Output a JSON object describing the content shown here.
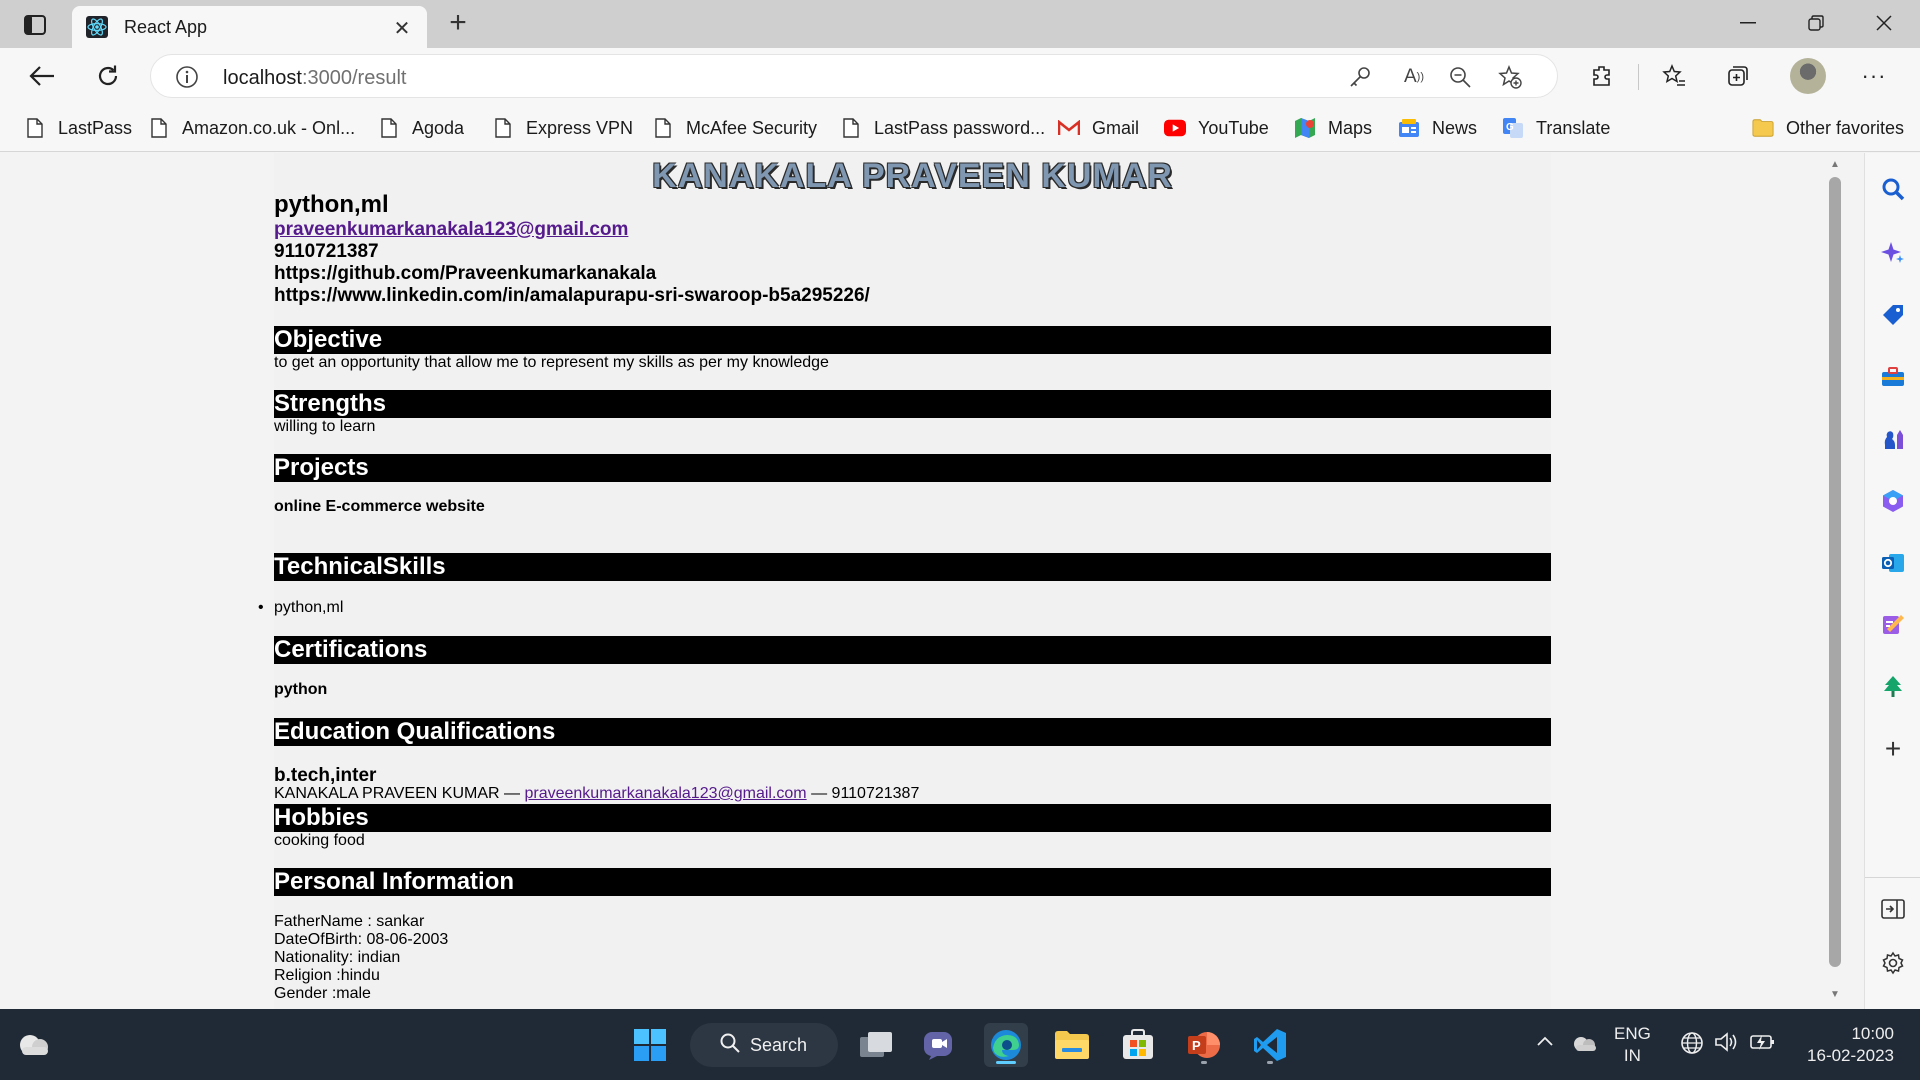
{
  "browser": {
    "tab_title": "React App",
    "url_host": "localhost",
    "url_rest": ":3000/result",
    "favorites": [
      {
        "label": "LastPass",
        "icon": "page-icon"
      },
      {
        "label": "Amazon.co.uk - Onl...",
        "icon": "page-icon"
      },
      {
        "label": "Agoda",
        "icon": "page-icon"
      },
      {
        "label": "Express VPN",
        "icon": "page-icon"
      },
      {
        "label": "McAfee Security",
        "icon": "page-icon"
      },
      {
        "label": "LastPass password...",
        "icon": "page-icon"
      },
      {
        "label": "Gmail",
        "icon": "gmail-icon"
      },
      {
        "label": "YouTube",
        "icon": "youtube-icon"
      },
      {
        "label": "Maps",
        "icon": "maps-icon"
      },
      {
        "label": "News",
        "icon": "news-icon"
      },
      {
        "label": "Translate",
        "icon": "translate-icon"
      }
    ],
    "other_favorites": "Other favorites"
  },
  "resume": {
    "name": "KANAKALA PRAVEEN KUMAR",
    "skills": "python,ml",
    "email": "praveenkumarkanakala123@gmail.com",
    "phone": "9110721387",
    "github": "https://github.com/Praveenkumarkanakala",
    "linkedin": "https://www.linkedin.com/in/amalapurapu-sri-swaroop-b5a295226/",
    "sections": {
      "objective": {
        "title": "Objective",
        "text": "to get an opportunity that allow me to represent my skills as per my knowledge"
      },
      "strengths": {
        "title": "Strengths",
        "text": "willing to learn"
      },
      "projects": {
        "title": "Projects",
        "text": "online E-commerce website"
      },
      "technical": {
        "title": "TechnicalSkills",
        "items": [
          "python,ml"
        ]
      },
      "certifications": {
        "title": "Certifications",
        "text": "python"
      },
      "education": {
        "title": "Education Qualifications",
        "degree": "b.tech,inter",
        "name": "KANAKALA PRAVEEN KUMAR",
        "sep": "—",
        "email": "praveenkumarkanakala123@gmail.com",
        "phone": "9110721387"
      },
      "hobbies": {
        "title": "Hobbies",
        "text": "cooking food"
      },
      "personal": {
        "title": "Personal Information",
        "lines": [
          "FatherName : sankar",
          "DateOfBirth: 08-06-2003",
          "Nationality: indian",
          "Religion :hindu",
          "Gender :male"
        ]
      }
    }
  },
  "taskbar": {
    "search_label": "Search",
    "lang_top": "ENG",
    "lang_bottom": "IN",
    "time": "10:00",
    "date": "16-02-2023"
  }
}
